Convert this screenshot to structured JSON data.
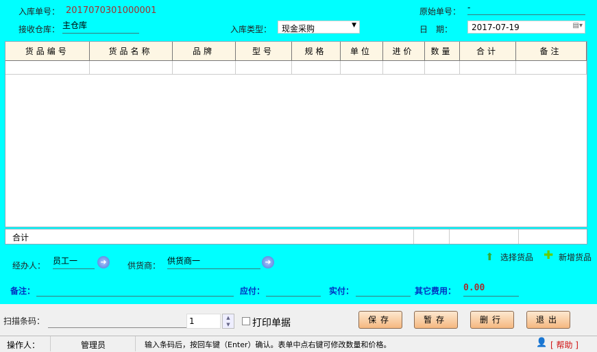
{
  "header": {
    "order_no_label": "入库单号：",
    "order_no": "2017070301000001",
    "orig_no_label": "原始单号：",
    "orig_no": "-",
    "warehouse_label": "接收仓库：",
    "warehouse": "主仓库",
    "type_label": "入库类型：",
    "type": "现金采购",
    "date_label": "日　期：",
    "date": "2017-07-19"
  },
  "table": {
    "columns": [
      "货品编号",
      "货品名称",
      "品牌",
      "型号",
      "规格",
      "单位",
      "进价",
      "数量",
      "合计",
      "备注"
    ],
    "total_label": "合计"
  },
  "form": {
    "handler_label": "经办人：",
    "handler": "员工一",
    "supplier_label": "供货商：",
    "supplier": "供货商一",
    "select_goods": "选择货品",
    "add_goods": "新增货品",
    "note_label": "备注：",
    "payable_label": "应付：",
    "paid_label": "实付：",
    "other_fee_label": "其它费用：",
    "other_fee": "0.00"
  },
  "bottom": {
    "scan_label": "扫描条码：",
    "qty": "1",
    "print_label": "打印单据",
    "save": "保存",
    "hold": "暂存",
    "delete_row": "删行",
    "exit": "退出"
  },
  "status": {
    "operator_label": "操作人：",
    "operator": "管理员",
    "hint": "输入条码后，按回车键（Enter）确认。表单中点右键可修改数量和价格。",
    "help": "[ 帮助 ]"
  }
}
